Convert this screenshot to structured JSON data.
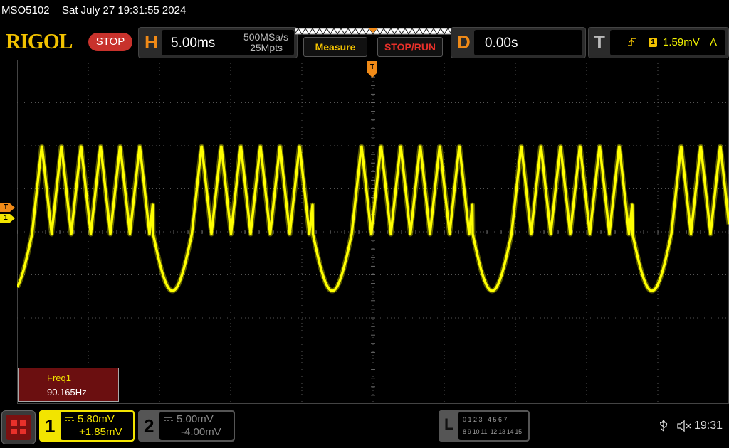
{
  "title_bar": {
    "model": "MSO5102",
    "datetime": "Sat July 27 19:31:55 2024"
  },
  "toolbar": {
    "logo": "RIGOL",
    "run_state": "STOP",
    "horizontal": {
      "letter": "H",
      "timebase": "5.00ms",
      "sample_rate": "500MSa/s",
      "memory_depth": "25Mpts"
    },
    "measure_label": "Measure",
    "stop_run_label": "STOP/RUN",
    "delay": {
      "letter": "D",
      "value": "0.00s"
    },
    "trigger": {
      "letter": "T",
      "edge_icon": "rising-edge-icon",
      "source": "1",
      "level": "1.59mV",
      "mode": "A"
    }
  },
  "screen": {
    "trigger_marker": "T",
    "trigger_level_marker": "T",
    "channel1_marker": "1"
  },
  "measurement": {
    "name": "Freq1",
    "value": "90.165Hz"
  },
  "bottom_bar": {
    "menu_icon": "menu-grid-icon",
    "ch1": {
      "number": "1",
      "scale": "5.80mV",
      "offset": "+1.85mV"
    },
    "ch2": {
      "number": "2",
      "scale": "5.00mV",
      "offset": "-4.00mV"
    },
    "la": {
      "letter": "L",
      "row1": "0 1 2 3   4 5 6 7",
      "row2": "8 9 10 11  12 13 14 15"
    },
    "usb_icon": "usb-icon",
    "volume_icon": "speaker-muted-icon",
    "clock": "19:31"
  },
  "colors": {
    "ch1": "#ffff00",
    "accent_orange": "#f08a17",
    "stop_red": "#c8322c",
    "logo_yellow": "#f2c200",
    "ch2": "#6e6e6e"
  }
}
